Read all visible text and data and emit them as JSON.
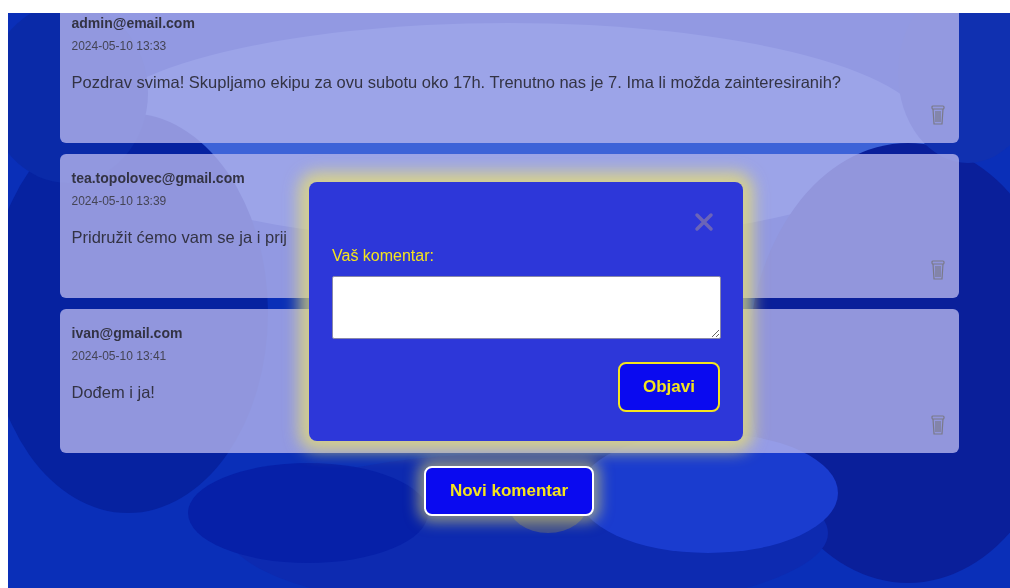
{
  "comments": [
    {
      "author": "admin@email.com",
      "time": "2024-05-10 13:33",
      "text": "Pozdrav svima! Skupljamo ekipu za ovu subotu oko 17h. Trenutno nas je 7. Ima li možda zainteresiranih?"
    },
    {
      "author": "tea.topolovec@gmail.com",
      "time": "2024-05-10 13:39",
      "text": "Pridružit ćemo vam se ja i prij"
    },
    {
      "author": "ivan@gmail.com",
      "time": "2024-05-10 13:41",
      "text": "Dođem i ja!"
    }
  ],
  "new_comment_button": "Novi komentar",
  "modal": {
    "label": "Vaš komentar:",
    "submit": "Objavi"
  }
}
